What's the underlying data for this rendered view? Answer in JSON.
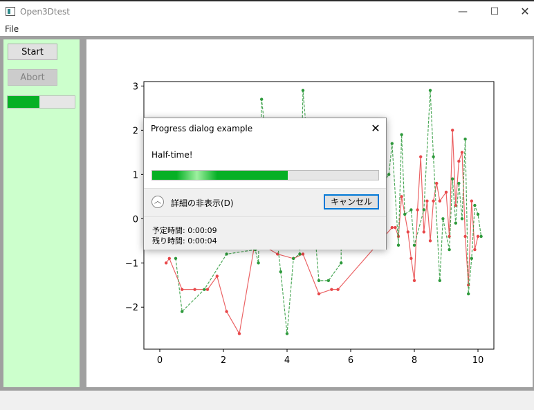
{
  "window": {
    "title": "Open3Dtest",
    "minimize_glyph": "—",
    "maximize_glyph": "☐",
    "close_glyph": "✕"
  },
  "menu": {
    "file": "File"
  },
  "sidebar": {
    "start_label": "Start",
    "abort_label": "Abort",
    "progress_fraction": 0.47
  },
  "dialog": {
    "title": "Progress dialog example",
    "close_glyph": "✕",
    "message": "Half-time!",
    "progress_fraction": 0.6,
    "details_toggle_glyph": "︿",
    "details_toggle_label": "詳細の非表示(D)",
    "cancel_label": "キャンセル",
    "details_lines": [
      "予定時間: 0:00:09",
      "残り時間: 0:00:04"
    ]
  },
  "colors": {
    "panel": "#ccffcc",
    "progress": "#06b025",
    "series_red": "#e8484a",
    "series_green": "#2e9a3c"
  },
  "chart_data": {
    "type": "line",
    "xlim": [
      -0.5,
      10.5
    ],
    "ylim": [
      -2.95,
      3.1
    ],
    "xticks": [
      0,
      2,
      4,
      6,
      8,
      10
    ],
    "yticks": [
      -2,
      -1,
      0,
      1,
      2,
      3
    ],
    "xtick_labels": [
      "0",
      "2",
      "4",
      "6",
      "8",
      "10"
    ],
    "ytick_labels": [
      "−2",
      "−1",
      "0",
      "1",
      "2",
      "3"
    ],
    "grid": false,
    "legend": "none",
    "series": [
      {
        "style": "solid",
        "color": "#e8484a",
        "points": [
          [
            0.2,
            -1.0
          ],
          [
            0.3,
            -0.9
          ],
          [
            0.7,
            -1.6
          ],
          [
            1.1,
            -1.6
          ],
          [
            1.5,
            -1.6
          ],
          [
            1.8,
            -1.3
          ],
          [
            2.1,
            -2.1
          ],
          [
            2.5,
            -2.6
          ],
          [
            3.0,
            -0.5
          ],
          [
            3.7,
            -0.8
          ],
          [
            4.2,
            -0.9
          ],
          [
            4.5,
            -0.8
          ],
          [
            5.0,
            -1.7
          ],
          [
            5.4,
            -1.6
          ],
          [
            5.6,
            -1.6
          ],
          [
            7.3,
            -0.2
          ],
          [
            7.4,
            -0.2
          ],
          [
            7.5,
            -0.4
          ],
          [
            7.6,
            0.5
          ],
          [
            7.8,
            -0.3
          ],
          [
            7.9,
            -0.9
          ],
          [
            8.0,
            -1.4
          ],
          [
            8.1,
            0.2
          ],
          [
            8.2,
            1.4
          ],
          [
            8.3,
            -0.3
          ],
          [
            8.4,
            0.4
          ],
          [
            8.5,
            -0.5
          ],
          [
            8.6,
            0.4
          ],
          [
            8.7,
            0.8
          ],
          [
            8.8,
            0.4
          ],
          [
            9.0,
            0.6
          ],
          [
            9.1,
            -0.4
          ],
          [
            9.2,
            2.0
          ],
          [
            9.3,
            0.3
          ],
          [
            9.4,
            1.3
          ],
          [
            9.5,
            1.5
          ],
          [
            9.6,
            -0.4
          ],
          [
            9.7,
            -1.5
          ],
          [
            9.8,
            0.4
          ],
          [
            9.9,
            -0.7
          ],
          [
            10.0,
            -0.4
          ]
        ]
      },
      {
        "style": "dashed",
        "color": "#2e9a3c",
        "points": [
          [
            0.5,
            -0.9
          ],
          [
            0.7,
            -2.1
          ],
          [
            1.4,
            -1.6
          ],
          [
            2.1,
            -0.8
          ],
          [
            3.0,
            -0.7
          ],
          [
            3.1,
            -1.0
          ],
          [
            3.2,
            2.7
          ],
          [
            3.8,
            -1.2
          ],
          [
            4.0,
            -2.6
          ],
          [
            4.2,
            -0.9
          ],
          [
            4.4,
            -0.8
          ],
          [
            4.5,
            2.9
          ],
          [
            5.0,
            -1.4
          ],
          [
            5.3,
            -1.4
          ],
          [
            5.7,
            -1.0
          ],
          [
            5.7,
            -0.6
          ],
          [
            7.2,
            1.0
          ],
          [
            7.3,
            1.7
          ],
          [
            7.5,
            -0.6
          ],
          [
            7.6,
            1.9
          ],
          [
            7.7,
            0.1
          ],
          [
            7.9,
            0.2
          ],
          [
            8.0,
            -0.6
          ],
          [
            8.3,
            0.2
          ],
          [
            8.5,
            2.9
          ],
          [
            8.6,
            1.4
          ],
          [
            8.8,
            -1.4
          ],
          [
            8.9,
            0.0
          ],
          [
            9.1,
            -0.7
          ],
          [
            9.2,
            0.9
          ],
          [
            9.3,
            -0.1
          ],
          [
            9.4,
            0.8
          ],
          [
            9.5,
            0.0
          ],
          [
            9.6,
            1.8
          ],
          [
            9.7,
            -1.7
          ],
          [
            9.8,
            -0.9
          ],
          [
            9.9,
            0.3
          ],
          [
            10.0,
            0.1
          ],
          [
            10.1,
            -0.4
          ]
        ]
      }
    ]
  }
}
